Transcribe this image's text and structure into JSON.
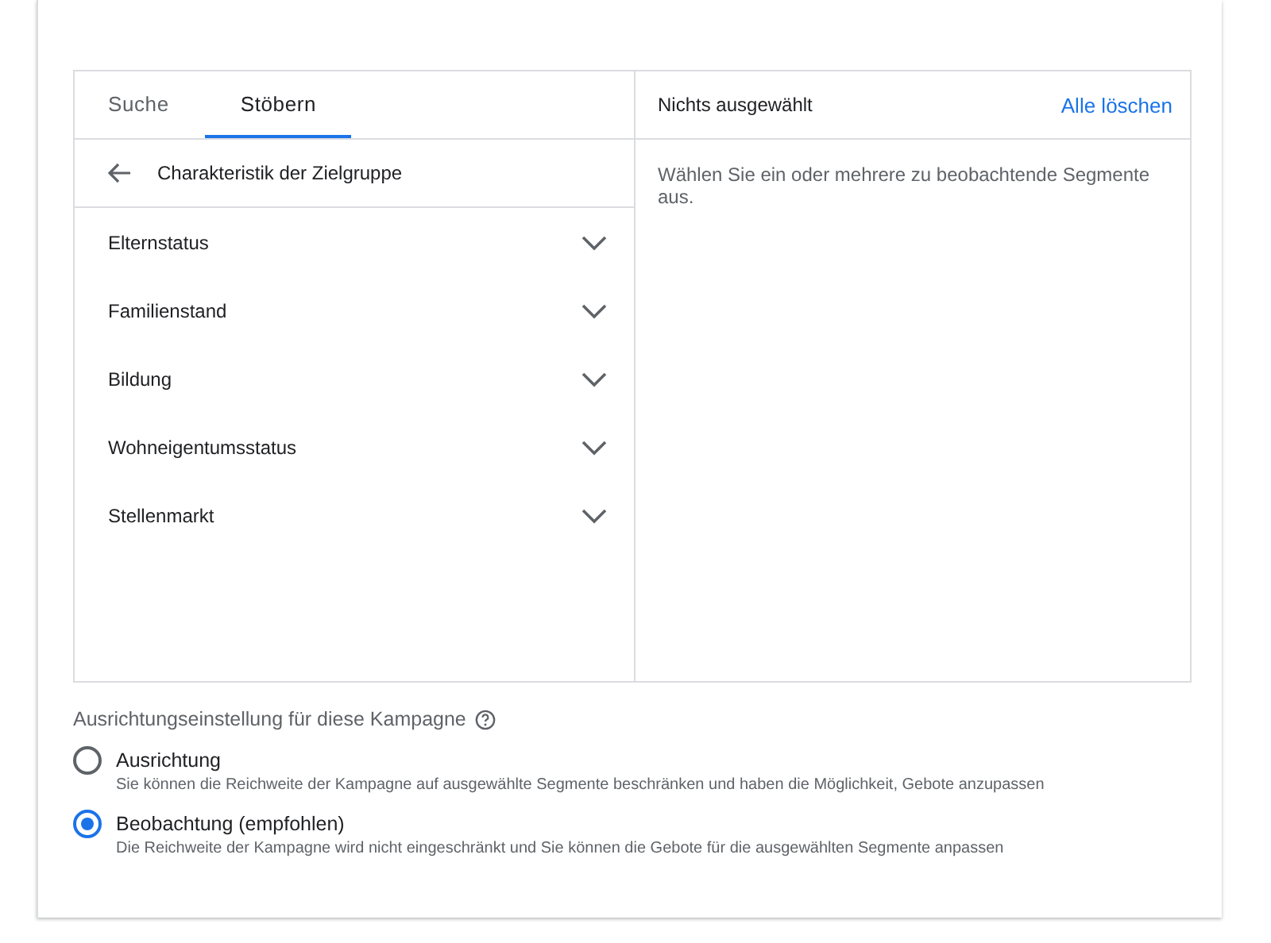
{
  "tabs": [
    {
      "label": "Suche",
      "selected": false
    },
    {
      "label": "Stöbern",
      "selected": true
    }
  ],
  "browse": {
    "title": "Charakteristik der Zielgruppe",
    "items": [
      {
        "label": "Elternstatus",
        "expanded": false
      },
      {
        "label": "Familienstand",
        "expanded": false
      },
      {
        "label": "Bildung",
        "expanded": false
      },
      {
        "label": "Wohneigentumsstatus",
        "expanded": false
      },
      {
        "label": "Stellenmarkt",
        "expanded": false
      }
    ]
  },
  "selection": {
    "status": "Nichts ausgewählt",
    "clear_link": "Alle löschen",
    "hint": "Wählen Sie ein oder mehrere zu beobachtende Segmente aus."
  },
  "targeting": {
    "title": "Ausrichtungseinstellung für diese Kampagne",
    "options": [
      {
        "label": "Ausrichtung",
        "description": "Sie können die Reichweite der Kampagne auf ausgewählte Segmente beschränken und haben die Möglichkeit, Gebote anzupassen",
        "selected": false
      },
      {
        "label": "Beobachtung (empfohlen)",
        "description": "Die Reichweite der Kampagne wird nicht eingeschränkt und Sie können die Gebote für die ausgewählten Segmente anpassen",
        "selected": true
      }
    ]
  }
}
